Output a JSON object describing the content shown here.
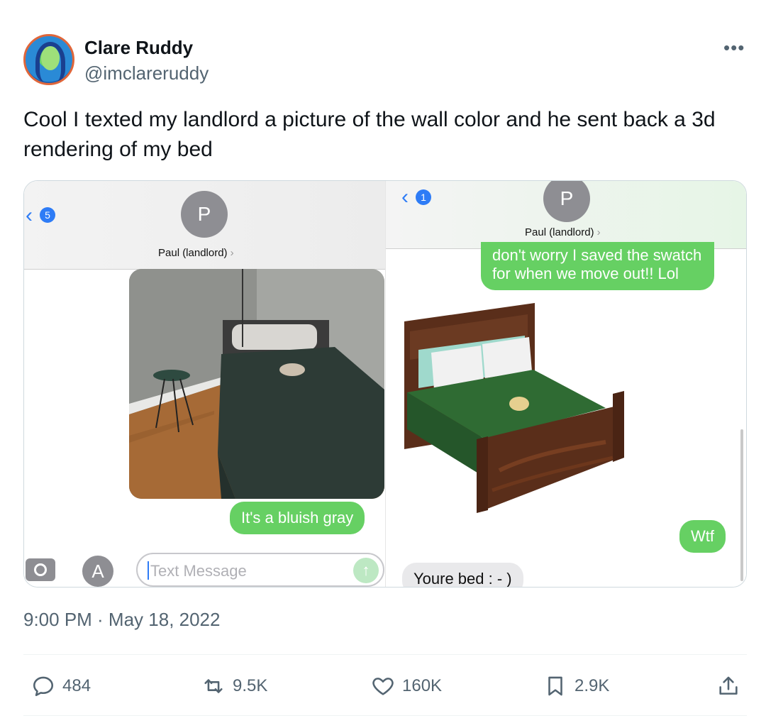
{
  "author": {
    "name": "Clare Ruddy",
    "handle": "@imclareruddy",
    "avatar_icon": "profile-photo"
  },
  "more_label": "•••",
  "tweet_text": "Cool I texted my landlord a picture of the wall color and he sent back a 3d rendering of my bed",
  "screenshot_left": {
    "back_badge": "5",
    "contact_initial": "P",
    "contact_name": "Paul (landlord)",
    "chevron": "›",
    "photo_subject": "bed-photo",
    "bubble_sent": "It's a bluish gray",
    "input_placeholder": "Text Message",
    "send_icon": "↑"
  },
  "screenshot_right": {
    "back_badge": "1",
    "contact_initial": "P",
    "contact_name": "Paul (landlord)",
    "chevron": "›",
    "bubble_top": "don't worry I saved the swatch\nfor when we move out!! Lol",
    "rendering_subject": "3d-bed-rendering",
    "bubble_sent": "Wtf",
    "bubble_received": "Youre bed : - )"
  },
  "timestamp": "9:00 PM · May 18, 2022",
  "actions": {
    "replies": "484",
    "reposts": "9.5K",
    "likes": "160K",
    "bookmarks": "2.9K"
  },
  "colors": {
    "imessage_green": "#66d063",
    "imessage_gray": "#e9e9eb",
    "ios_blue": "#2e7cf6",
    "secondary_text": "#536471"
  }
}
